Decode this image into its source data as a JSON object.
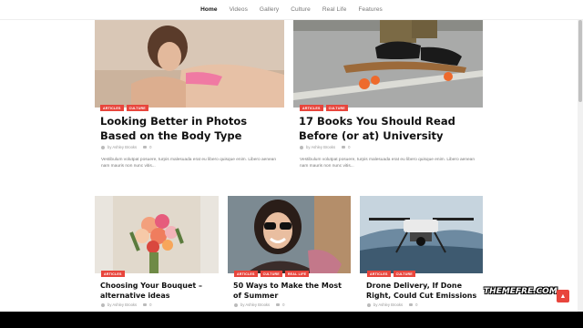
{
  "nav": {
    "items": [
      {
        "label": "Home",
        "active": true
      },
      {
        "label": "Videos",
        "active": false
      },
      {
        "label": "Gallery",
        "active": false
      },
      {
        "label": "Culture",
        "active": false
      },
      {
        "label": "Real Life",
        "active": false
      },
      {
        "label": "Features",
        "active": false
      }
    ]
  },
  "posts": [
    {
      "title": "Looking Better in Photos Based on the Body Type",
      "tags": [
        "Articles",
        "Culture"
      ],
      "author": "by Ashley Brooks",
      "comments": "0",
      "excerpt": "Vestibulum volutpat posuere, turpis malesuada erat eu libero quisque enim. Libero aenean nam mauris non nunc vitis..."
    },
    {
      "title": "17 Books You Should Read Before (or at) University",
      "tags": [
        "Articles",
        "Culture"
      ],
      "author": "by Ashley Brooks",
      "comments": "0",
      "excerpt": "Vestibulum volutpat posuere, turpis malesuada erat eu libero quisque enim. Libero aenean nam mauris non nunc vitis..."
    },
    {
      "title": "Choosing Your Bouquet – alternative ideas",
      "tags": [
        "Articles"
      ],
      "author": "by Ashley Brooks",
      "comments": "0"
    },
    {
      "title": "50 Ways to Make the Most of Summer",
      "tags": [
        "Articles",
        "Culture",
        "Real Life"
      ],
      "author": "by Ashley Brooks",
      "comments": "0"
    },
    {
      "title": "Drone Delivery, If Done Right, Could Cut Emissions",
      "tags": [
        "Articles",
        "Culture"
      ],
      "author": "by Ashley Brooks",
      "comments": "0"
    }
  ],
  "watermark": "THEMEFRE.COM",
  "back_to_top_icon": "chevron-up-icon",
  "colors": {
    "accent": "#e8453c"
  }
}
